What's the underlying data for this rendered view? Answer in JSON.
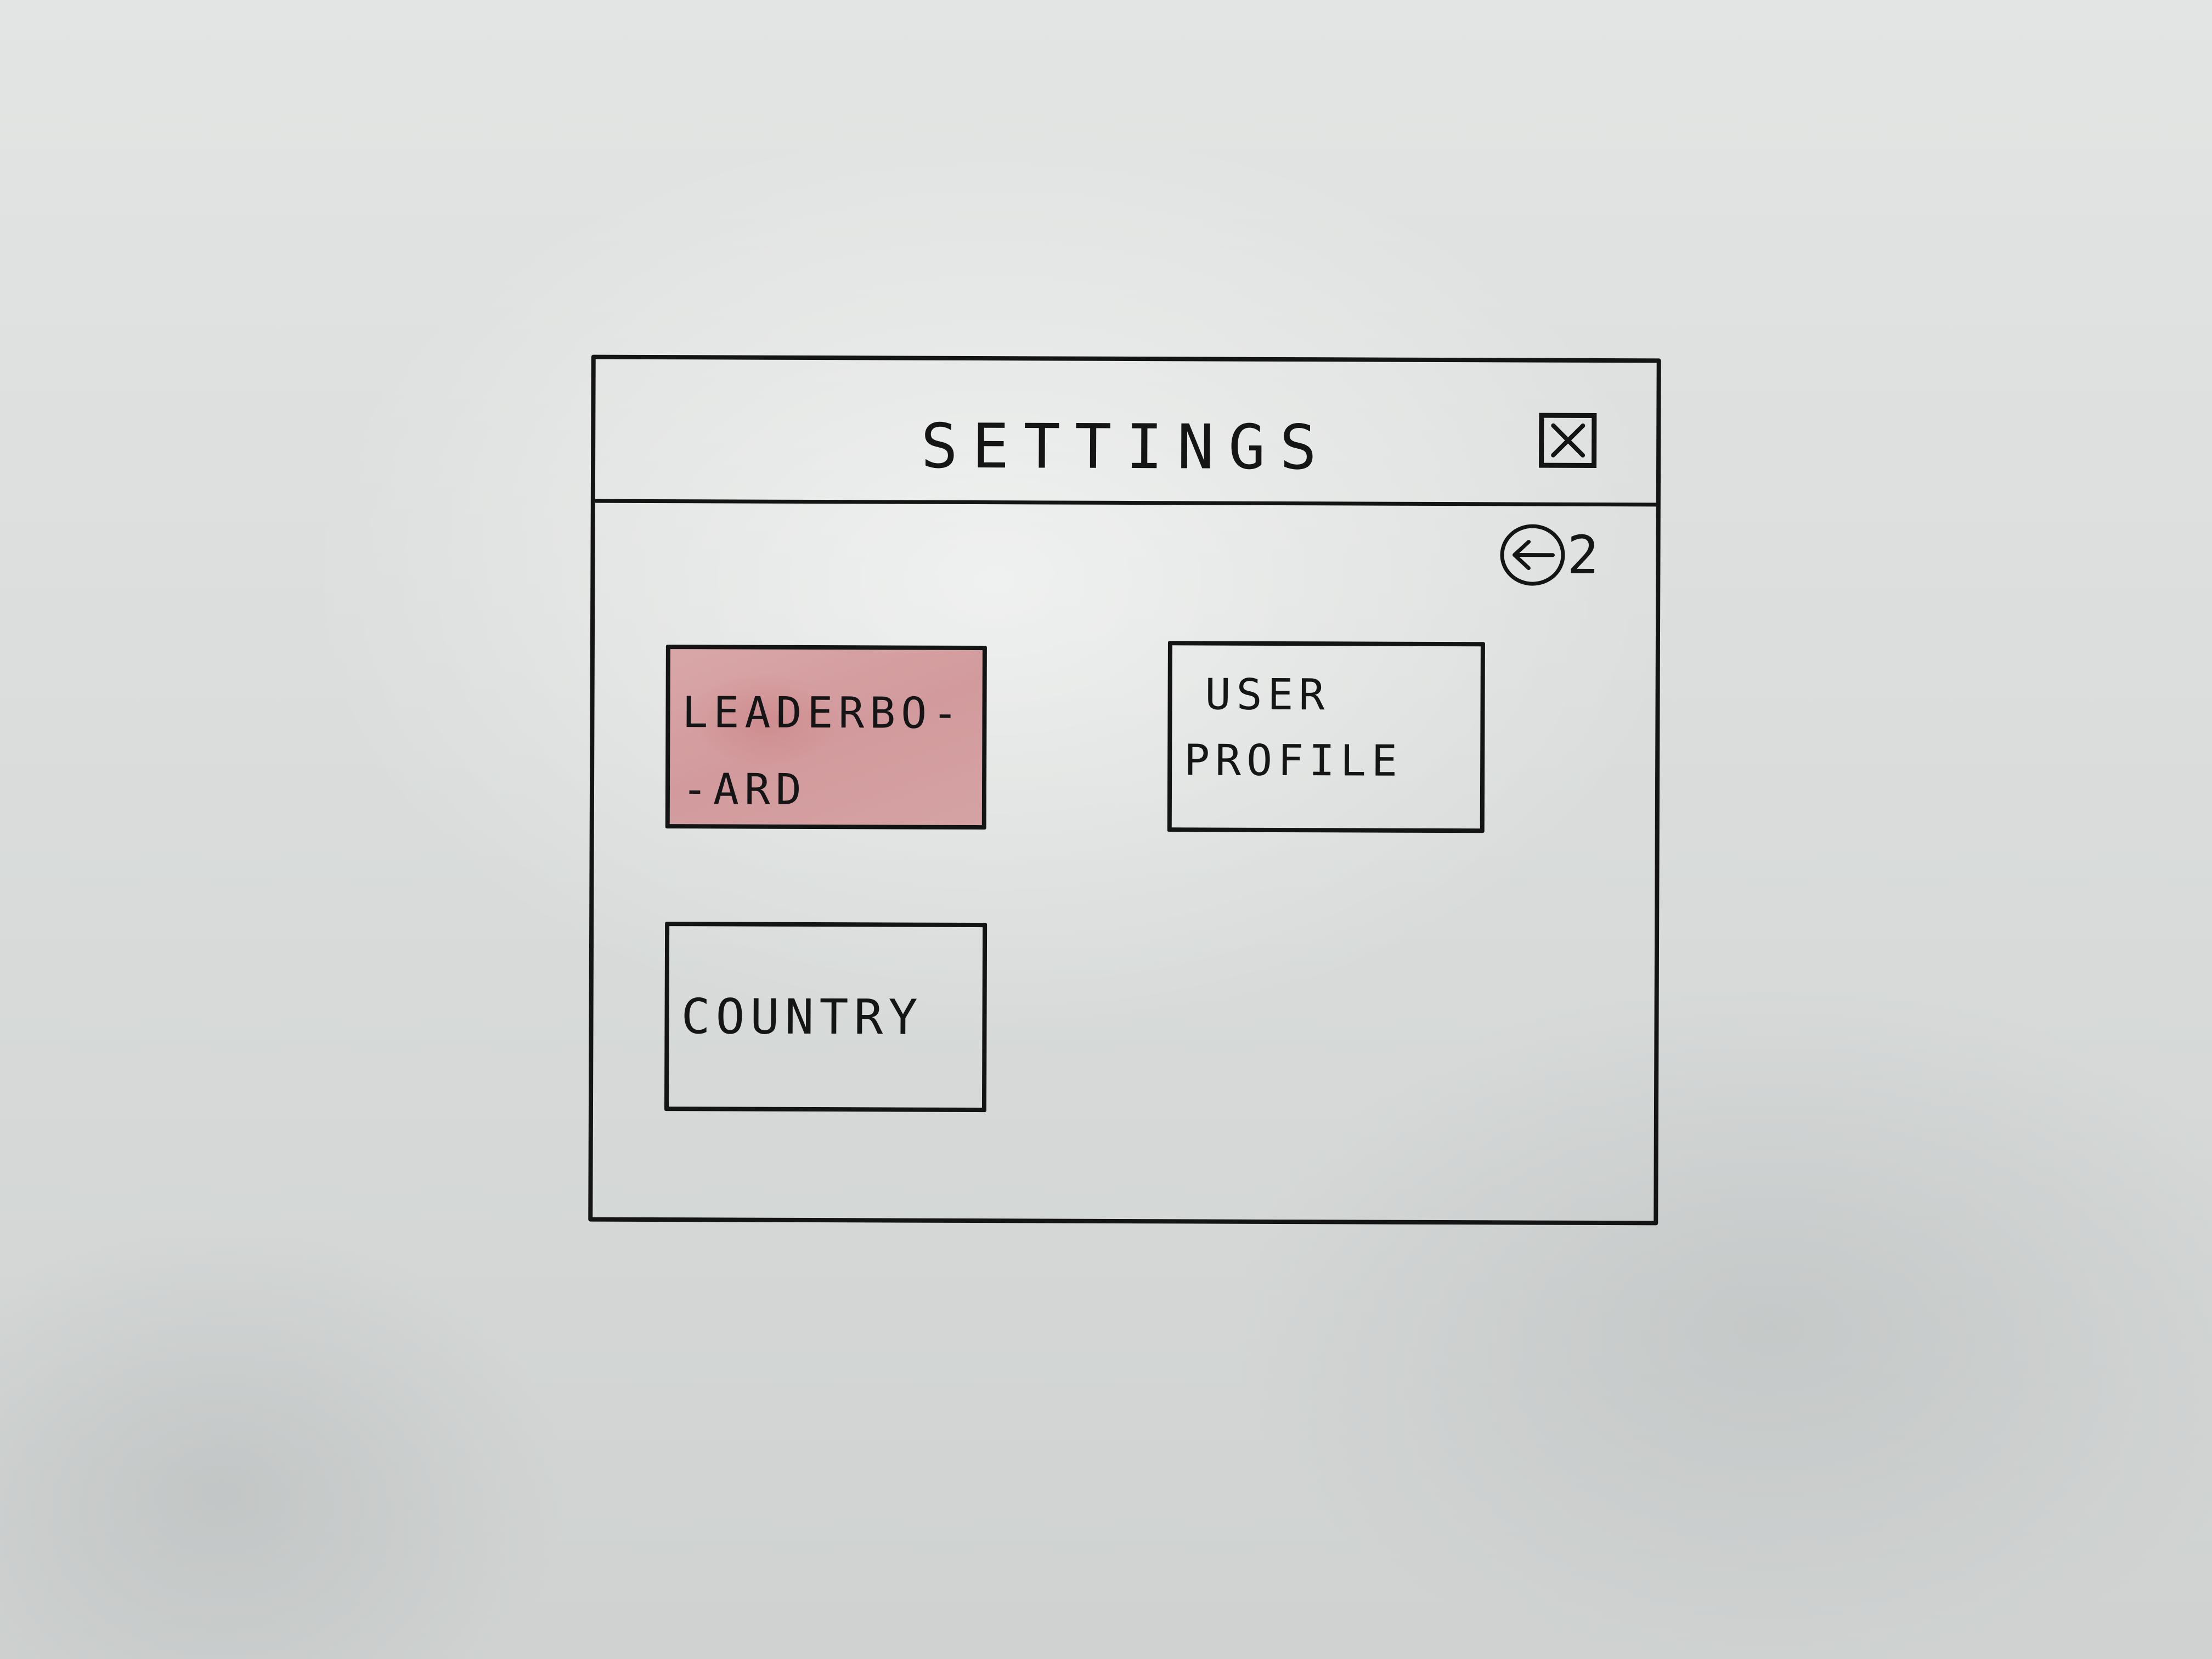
{
  "window": {
    "title": "SETTINGS",
    "close_icon": "close-icon",
    "back_icon": "back-arrow-icon",
    "back_annotation": "2"
  },
  "tiles": [
    {
      "id": "leaderboard",
      "line1": "LEADERBO-",
      "line2": "-ARD",
      "fill": "#d49fa1"
    },
    {
      "id": "user-profile",
      "line1": "USER",
      "line2": "PROFILE"
    },
    {
      "id": "country",
      "label": "COUNTRY"
    }
  ],
  "colors": {
    "ink": "#141414",
    "highlight": "#d49fa1",
    "paper": "#dcdfde"
  }
}
